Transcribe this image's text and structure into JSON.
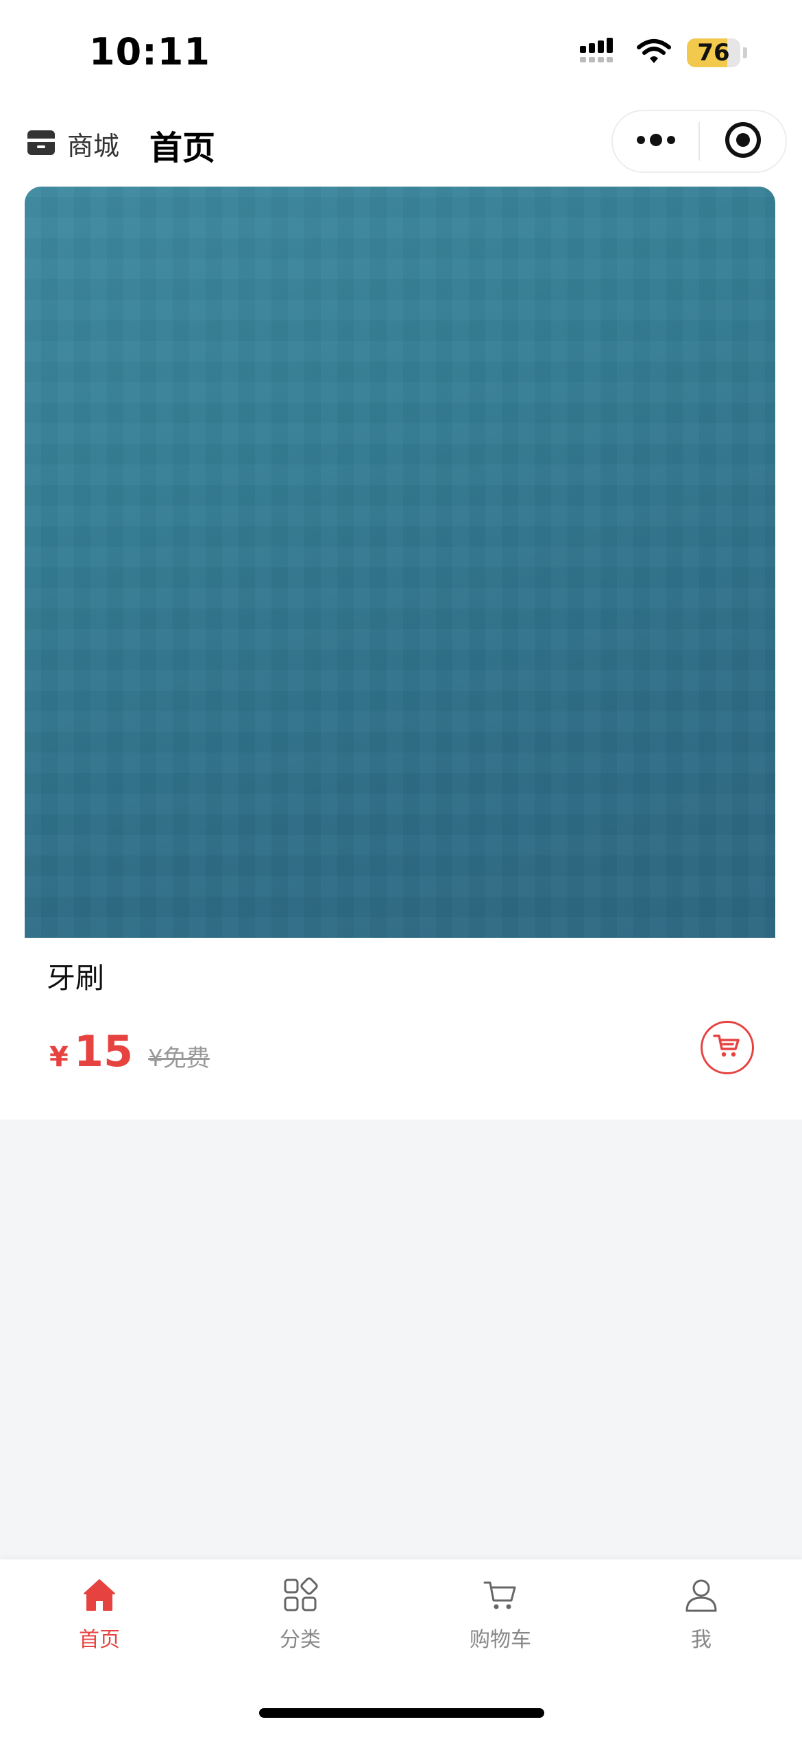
{
  "status_bar": {
    "time": "10:11",
    "battery_level": "76",
    "battery_fill_percent": 76
  },
  "nav": {
    "brand_label": "商城",
    "title": "首页"
  },
  "product": {
    "name": "牙刷",
    "currency_symbol": "¥",
    "price": "15",
    "original_price": "¥免费"
  },
  "tabbar": {
    "items": [
      {
        "label": "首页",
        "icon": "home-icon",
        "active": true
      },
      {
        "label": "分类",
        "icon": "category-icon",
        "active": false
      },
      {
        "label": "购物车",
        "icon": "cart-icon",
        "active": false
      },
      {
        "label": "我",
        "icon": "user-icon",
        "active": false
      }
    ]
  },
  "colors": {
    "accent": "#e64340",
    "image_bg": "#357d94",
    "inactive": "#888888"
  }
}
